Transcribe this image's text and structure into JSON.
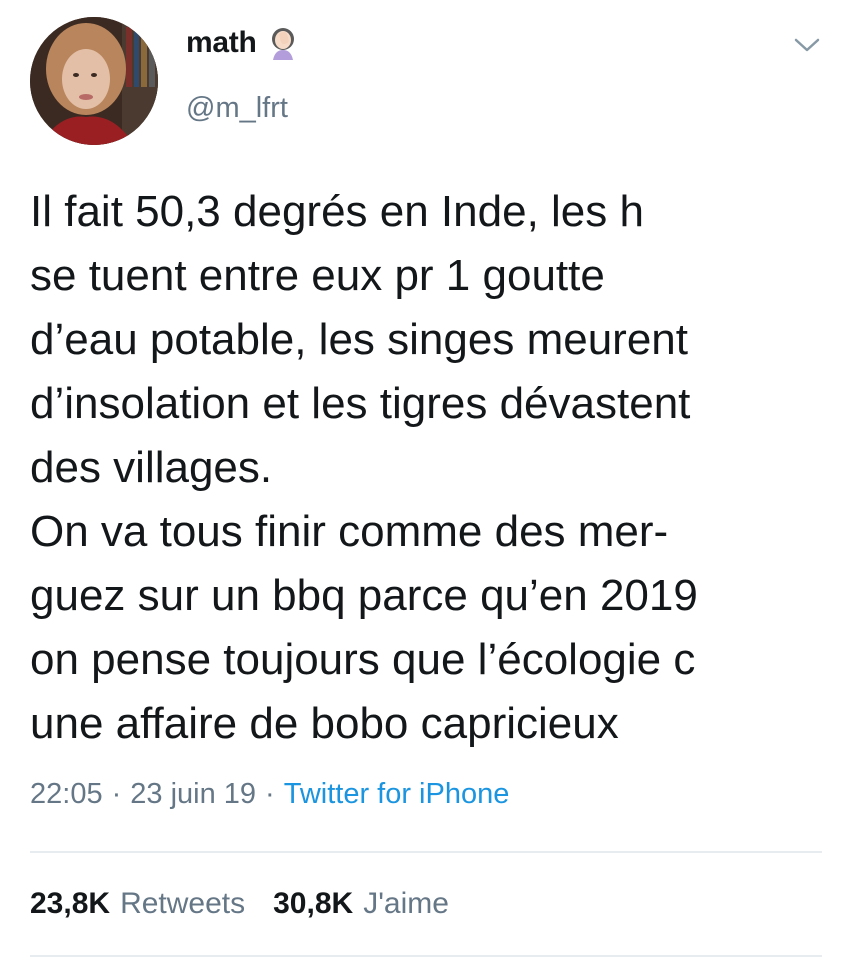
{
  "user": {
    "display_name": "math",
    "handle": "@m_lfrt",
    "name_emoji": "woman-facepalming-icon"
  },
  "tweet": {
    "lines": [
      "Il fait 50,3 degrés en Inde, les h",
      "se tuent entre eux pr 1 goutte",
      "d’eau potable, les singes meurent",
      "d’insolation et les tigres dévastent",
      "des villages.",
      "On va tous finir comme des mer-",
      "guez sur un bbq parce qu’en 2019",
      "on pense toujours que l’écologie c",
      "une affaire de bobo capricieux"
    ]
  },
  "meta": {
    "time": "22:05",
    "sep1": "·",
    "date": "23 juin 19",
    "sep2": "·",
    "source": "Twitter for iPhone"
  },
  "stats": {
    "retweets_count": "23,8K",
    "retweets_label": "Retweets",
    "likes_count": "30,8K",
    "likes_label": "J'aime"
  },
  "colors": {
    "text": "#14171a",
    "secondary": "#657786",
    "link": "#1b95e0",
    "divider": "#e6ecf0"
  }
}
